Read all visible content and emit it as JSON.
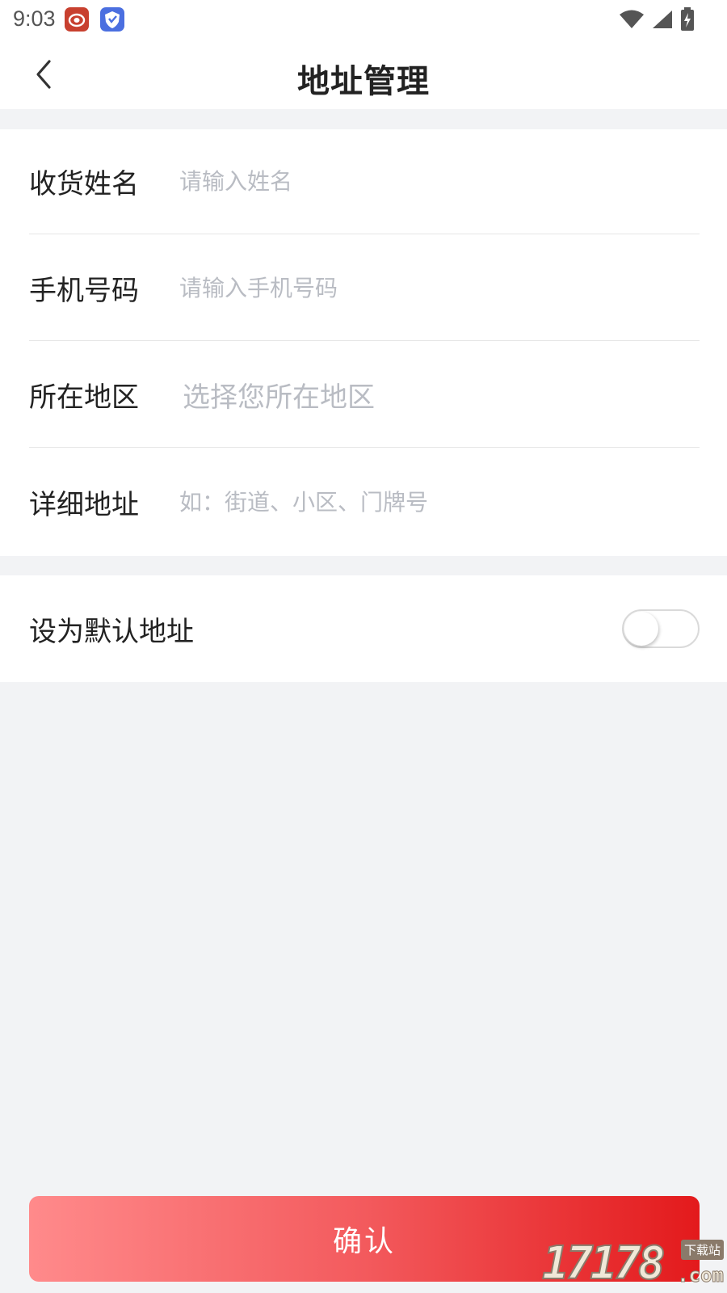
{
  "status_bar": {
    "time": "9:03",
    "app_icons": [
      "weibo-icon",
      "shield-app-icon"
    ],
    "indicators": [
      "wifi-icon",
      "signal-icon",
      "battery-charging-icon"
    ]
  },
  "header": {
    "title": "地址管理",
    "back_icon": "chevron-left-icon"
  },
  "form": {
    "name": {
      "label": "收货姓名",
      "placeholder": "请输入姓名",
      "value": ""
    },
    "phone": {
      "label": "手机号码",
      "placeholder": "请输入手机号码",
      "value": ""
    },
    "region": {
      "label": "所在地区",
      "placeholder": "选择您所在地区"
    },
    "address": {
      "label": "详细地址",
      "placeholder": "如：街道、小区、门牌号",
      "value": ""
    }
  },
  "default_address": {
    "label": "设为默认地址",
    "enabled": false
  },
  "confirm": {
    "label": "确认"
  },
  "watermark": {
    "number": "17178",
    "suffix": ".com",
    "tag": "下载站"
  },
  "colors": {
    "accent_start": "#ff8a8b",
    "accent_end": "#e31a1c",
    "placeholder": "#b9bcc3",
    "background": "#f2f3f5"
  }
}
